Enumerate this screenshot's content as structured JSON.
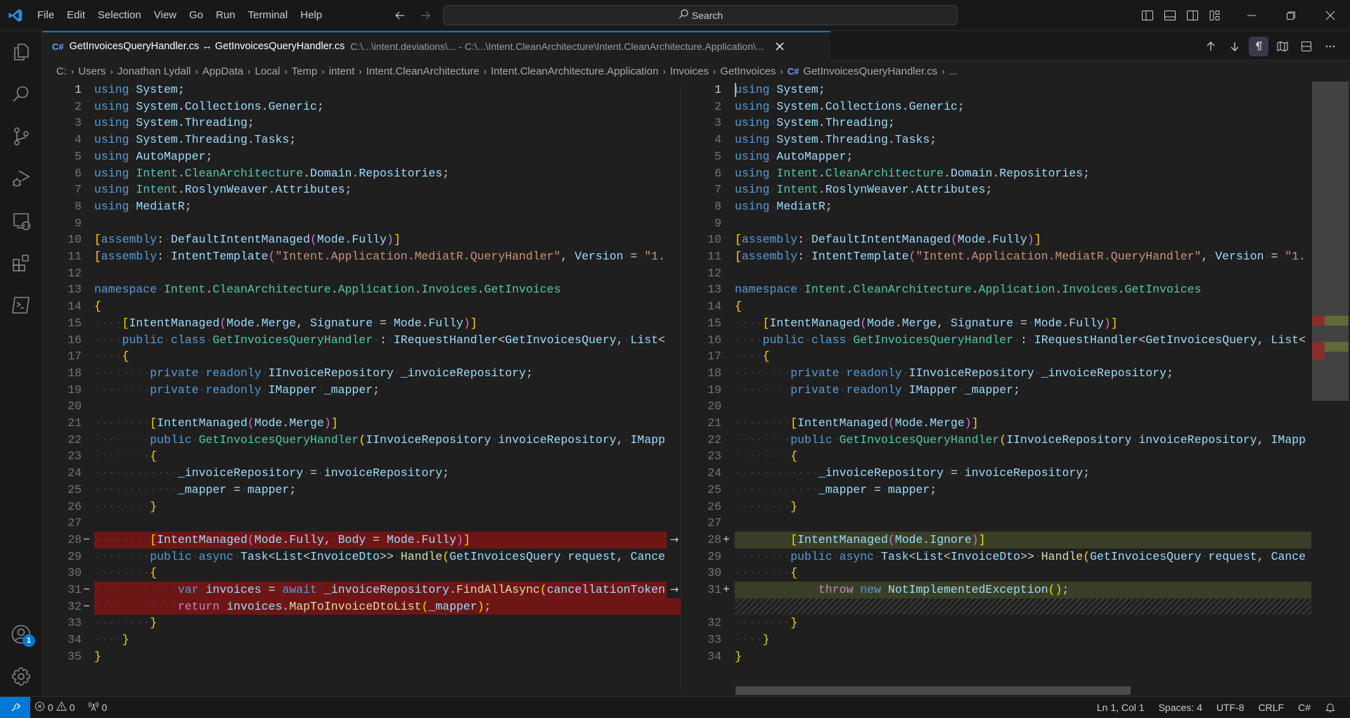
{
  "titlebar": {
    "menu": [
      "File",
      "Edit",
      "Selection",
      "View",
      "Go",
      "Run",
      "Terminal",
      "Help"
    ],
    "search_label": "Search"
  },
  "activitybar": {
    "items": [
      "explorer",
      "search",
      "source-control",
      "run-and-debug",
      "remote-explorer",
      "extensions",
      "terminal"
    ],
    "accounts_badge": "1"
  },
  "tab": {
    "title": "GetInvoicesQueryHandler.cs ↔ GetInvoicesQueryHandler.cs",
    "description": "C:\\...\\intent.deviations\\... - C:\\...\\Intent.CleanArchitecture\\Intent.CleanArchitecture.Application\\...",
    "language_icon": "C#"
  },
  "breadcrumb": [
    "C:",
    "Users",
    "Jonathan Lydall",
    "AppData",
    "Local",
    "Temp",
    "intent",
    "Intent.CleanArchitecture",
    "Intent.CleanArchitecture.Application",
    "Invoices",
    "GetInvoices",
    "GetInvoicesQueryHandler.cs",
    "..."
  ],
  "diff": {
    "left": {
      "lines": [
        {
          "n": "1",
          "text": "using System;"
        },
        {
          "n": "2",
          "text": "using System.Collections.Generic;"
        },
        {
          "n": "3",
          "text": "using System.Threading;"
        },
        {
          "n": "4",
          "text": "using System.Threading.Tasks;"
        },
        {
          "n": "5",
          "text": "using AutoMapper;"
        },
        {
          "n": "6",
          "text": "using Intent.CleanArchitecture.Domain.Repositories;"
        },
        {
          "n": "7",
          "text": "using Intent.RoslynWeaver.Attributes;"
        },
        {
          "n": "8",
          "text": "using MediatR;"
        },
        {
          "n": "9",
          "text": ""
        },
        {
          "n": "10",
          "text": "[assembly: DefaultIntentManaged(Mode.Fully)]"
        },
        {
          "n": "11",
          "text": "[assembly: IntentTemplate(\"Intent.Application.MediatR.QueryHandler\", Version = \"1."
        },
        {
          "n": "12",
          "text": ""
        },
        {
          "n": "13",
          "text": "namespace Intent.CleanArchitecture.Application.Invoices.GetInvoices"
        },
        {
          "n": "14",
          "text": "{"
        },
        {
          "n": "15",
          "text": "    [IntentManaged(Mode.Merge, Signature = Mode.Fully)]"
        },
        {
          "n": "16",
          "text": "    public class GetInvoicesQueryHandler : IRequestHandler<GetInvoicesQuery, List<"
        },
        {
          "n": "17",
          "text": "    {"
        },
        {
          "n": "18",
          "text": "        private readonly IInvoiceRepository _invoiceRepository;"
        },
        {
          "n": "19",
          "text": "        private readonly IMapper _mapper;"
        },
        {
          "n": "20",
          "text": ""
        },
        {
          "n": "21",
          "text": "        [IntentManaged(Mode.Merge)]"
        },
        {
          "n": "22",
          "text": "        public GetInvoicesQueryHandler(IInvoiceRepository invoiceRepository, IMapp"
        },
        {
          "n": "23",
          "text": "        {"
        },
        {
          "n": "24",
          "text": "            _invoiceRepository = invoiceRepository;"
        },
        {
          "n": "25",
          "text": "            _mapper = mapper;"
        },
        {
          "n": "26",
          "text": "        }"
        },
        {
          "n": "27",
          "text": ""
        },
        {
          "n": "28",
          "text": "        [IntentManaged(Mode.Fully, Body = Mode.Fully)]",
          "change": "removed"
        },
        {
          "n": "29",
          "text": "        public async Task<List<InvoiceDto>> Handle(GetInvoicesQuery request, Cance"
        },
        {
          "n": "30",
          "text": "        {"
        },
        {
          "n": "31",
          "text": "            var invoices = await _invoiceRepository.FindAllAsync(cancellationToken",
          "change": "removed"
        },
        {
          "n": "32",
          "text": "            return invoices.MapToInvoiceDtoList(_mapper);",
          "change": "removed"
        },
        {
          "n": "33",
          "text": "        }"
        },
        {
          "n": "34",
          "text": "    }"
        },
        {
          "n": "35",
          "text": "}"
        }
      ]
    },
    "right": {
      "lines": [
        {
          "n": "1",
          "text": "using System;"
        },
        {
          "n": "2",
          "text": "using System.Collections.Generic;"
        },
        {
          "n": "3",
          "text": "using System.Threading;"
        },
        {
          "n": "4",
          "text": "using System.Threading.Tasks;"
        },
        {
          "n": "5",
          "text": "using AutoMapper;"
        },
        {
          "n": "6",
          "text": "using Intent.CleanArchitecture.Domain.Repositories;"
        },
        {
          "n": "7",
          "text": "using Intent.RoslynWeaver.Attributes;"
        },
        {
          "n": "8",
          "text": "using MediatR;"
        },
        {
          "n": "9",
          "text": ""
        },
        {
          "n": "10",
          "text": "[assembly: DefaultIntentManaged(Mode.Fully)]"
        },
        {
          "n": "11",
          "text": "[assembly: IntentTemplate(\"Intent.Application.MediatR.QueryHandler\", Version = \"1."
        },
        {
          "n": "12",
          "text": ""
        },
        {
          "n": "13",
          "text": "namespace Intent.CleanArchitecture.Application.Invoices.GetInvoices"
        },
        {
          "n": "14",
          "text": "{"
        },
        {
          "n": "15",
          "text": "    [IntentManaged(Mode.Merge, Signature = Mode.Fully)]"
        },
        {
          "n": "16",
          "text": "    public class GetInvoicesQueryHandler : IRequestHandler<GetInvoicesQuery, List<"
        },
        {
          "n": "17",
          "text": "    {"
        },
        {
          "n": "18",
          "text": "        private readonly IInvoiceRepository _invoiceRepository;"
        },
        {
          "n": "19",
          "text": "        private readonly IMapper _mapper;"
        },
        {
          "n": "20",
          "text": ""
        },
        {
          "n": "21",
          "text": "        [IntentManaged(Mode.Merge)]"
        },
        {
          "n": "22",
          "text": "        public GetInvoicesQueryHandler(IInvoiceRepository invoiceRepository, IMapp"
        },
        {
          "n": "23",
          "text": "        {"
        },
        {
          "n": "24",
          "text": "            _invoiceRepository = invoiceRepository;"
        },
        {
          "n": "25",
          "text": "            _mapper = mapper;"
        },
        {
          "n": "26",
          "text": "        }"
        },
        {
          "n": "27",
          "text": ""
        },
        {
          "n": "28",
          "text": "        [IntentManaged(Mode.Ignore)]",
          "change": "added"
        },
        {
          "n": "29",
          "text": "        public async Task<List<InvoiceDto>> Handle(GetInvoicesQuery request, Cance"
        },
        {
          "n": "30",
          "text": "        {"
        },
        {
          "n": "31",
          "text": "            throw new NotImplementedException();",
          "change": "added"
        },
        {
          "n": "",
          "text": "",
          "change": "filler"
        },
        {
          "n": "32",
          "text": "        }"
        },
        {
          "n": "33",
          "text": "    }"
        },
        {
          "n": "34",
          "text": "}"
        }
      ]
    }
  },
  "statusbar": {
    "errors": "0",
    "warnings": "0",
    "ports": "0",
    "cursor": "Ln 1, Col 1",
    "indent": "Spaces: 4",
    "encoding": "UTF-8",
    "eol": "CRLF",
    "language": "C#"
  },
  "colors": {
    "accent": "#0078d4",
    "removed_line": "#6e1616",
    "added_line": "#393f26"
  }
}
